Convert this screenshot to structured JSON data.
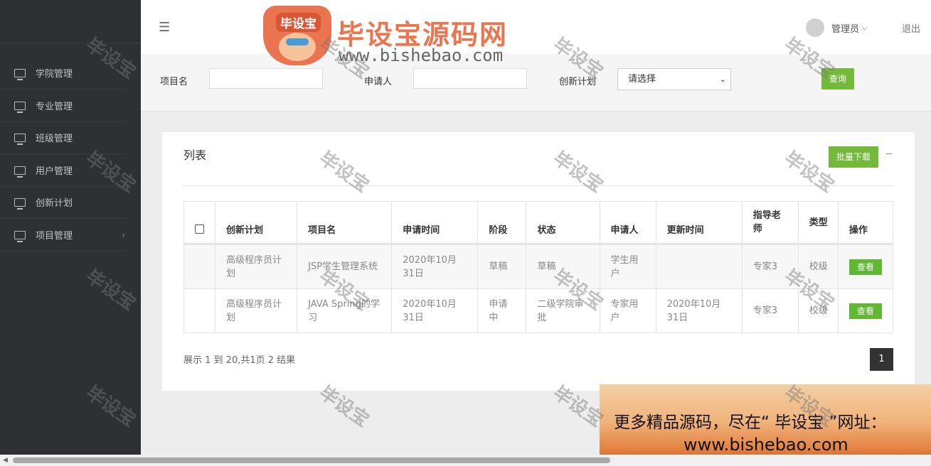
{
  "sidebar": {
    "items": [
      {
        "label": "学院管理"
      },
      {
        "label": "专业管理"
      },
      {
        "label": "班级管理"
      },
      {
        "label": "用户管理"
      },
      {
        "label": "创新计划"
      },
      {
        "label": "项目管理",
        "arrow": "›"
      }
    ]
  },
  "topbar": {
    "menu_icon": "☰",
    "user": "管理员",
    "user_chevron": "⌵",
    "logout": "退出",
    "logo_badge": "毕设宝",
    "logo_title": "毕设宝源码网",
    "logo_url": "www.bishebao.com"
  },
  "filter": {
    "project_label": "项目名",
    "applicant_label": "申请人",
    "plan_label": "创新计划",
    "plan_select": "请选择",
    "query_button": "查询"
  },
  "list": {
    "title": "列表",
    "batch_download": "批量下载",
    "minimize": "—",
    "columns": [
      "创新计划",
      "项目名",
      "申请时间",
      "阶段",
      "状态",
      "申请人",
      "更新时间",
      "指导老师",
      "类型",
      "操作"
    ],
    "rows": [
      {
        "plan": "高级程序员计划",
        "project": "JSP学生管理系统",
        "apply_time": "2020年10月31日",
        "stage": "草稿",
        "status": "草稿",
        "applicant": "学生用户",
        "update_time": "",
        "teacher": "专家3",
        "type": "校级",
        "action": "查看"
      },
      {
        "plan": "高级程序员计划",
        "project": "JAVA Spring的学习",
        "apply_time": "2020年10月31日",
        "stage": "申请中",
        "status": "二级学院审批",
        "applicant": "专家用户",
        "update_time": "2020年10月31日",
        "teacher": "专家3",
        "type": "校级",
        "action": "查看"
      }
    ],
    "summary": "展示 1 到 20,共1页 2 结果",
    "page": "1"
  },
  "watermark": "毕设宝",
  "banner": {
    "line1": "更多精品源码，尽在“ 毕设宝 ”网址：",
    "line2": "www.bishebao.com"
  },
  "scrollbar": {
    "left_arrow": "◀"
  }
}
